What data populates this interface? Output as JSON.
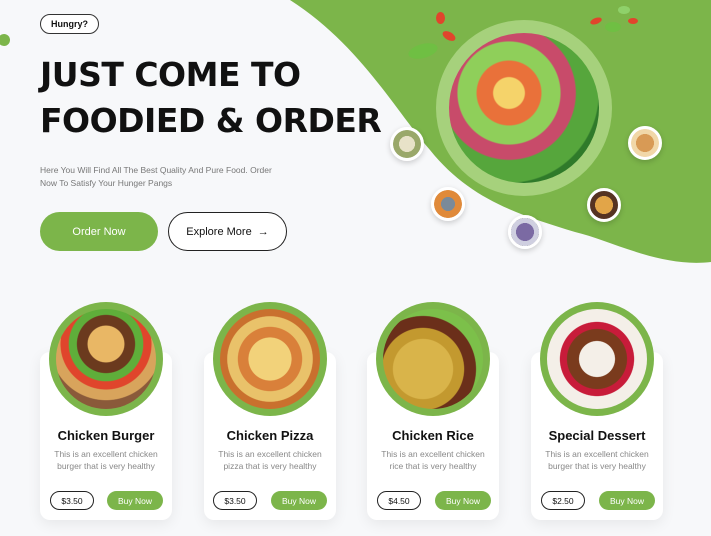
{
  "hero": {
    "tag": "Hungry?",
    "headline_line1": "JUST COME TO",
    "headline_line2": "FOODIED & ORDER",
    "subtext": "Here You Will Find All The Best Quality And Pure Food. Order Now To Satisfy Your Hunger Pangs",
    "order_button": "Order Now",
    "explore_button": "Explore More",
    "explore_arrow": "→"
  },
  "colors": {
    "accent": "#7cb54a",
    "accent_light": "#a6d17c",
    "background": "#f7f8fa"
  },
  "cards": [
    {
      "title": "Chicken Burger",
      "desc": "This is an excellent chicken burger that is very healthy",
      "price": "$3.50",
      "buy": "Buy Now"
    },
    {
      "title": "Chicken Pizza",
      "desc": "This is an excellent chicken pizza that is very healthy",
      "price": "$3.50",
      "buy": "Buy Now"
    },
    {
      "title": "Chicken Rice",
      "desc": "This is an excellent chicken rice that is very healthy",
      "price": "$4.50",
      "buy": "Buy Now"
    },
    {
      "title": "Special Dessert",
      "desc": "This is an excellent chicken burger that is very healthy",
      "price": "$2.50",
      "buy": "Buy Now"
    }
  ]
}
